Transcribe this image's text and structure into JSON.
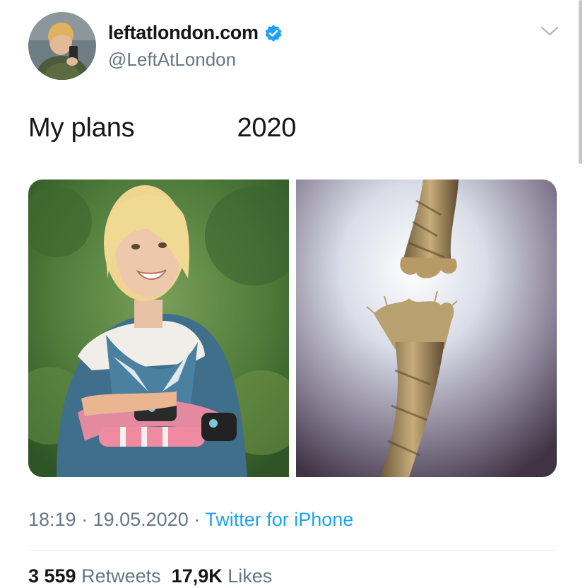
{
  "tweet": {
    "author": {
      "display_name": "leftatlondon.com",
      "handle": "@LeftAtLondon",
      "verified_icon": "verified-badge-icon",
      "avatar": "profile-photo"
    },
    "menu_icon": "chevron-down-icon",
    "text": "My plans              2020",
    "media": [
      {
        "description": "smiling-girl-photo"
      },
      {
        "description": "frayed-rope-photo"
      }
    ],
    "time": "18:19",
    "separator": " · ",
    "date": "19.05.2020",
    "source": "Twitter for iPhone",
    "retweets_count": "3 559",
    "retweets_label": "Retweets",
    "likes_count": "17,9K",
    "likes_label": "Likes"
  },
  "colors": {
    "accent": "#1da1f2",
    "secondary_text": "#657786",
    "primary_text": "#14171a"
  }
}
